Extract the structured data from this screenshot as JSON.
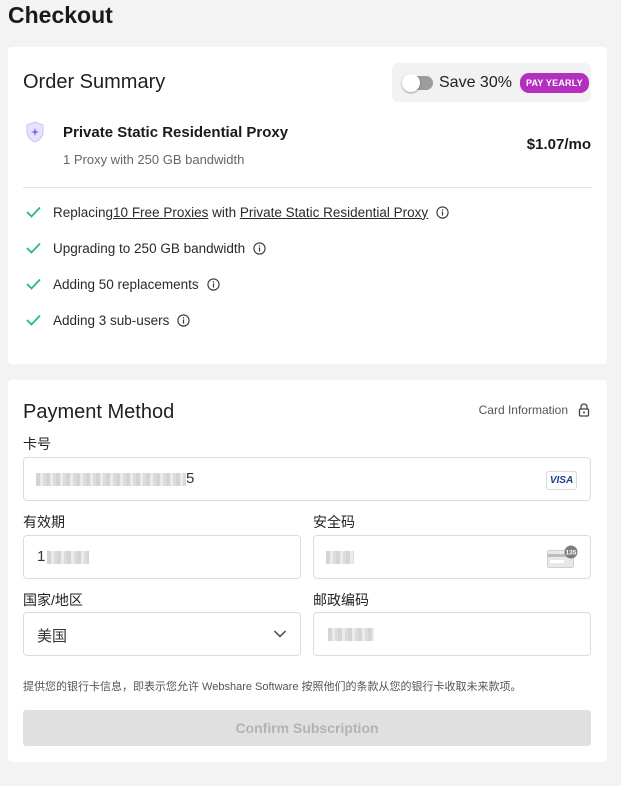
{
  "page": {
    "title": "Checkout"
  },
  "order_summary": {
    "title": "Order Summary",
    "save_label": "Save 30%",
    "pay_yearly": "PAY YEARLY",
    "product_icon": "shield-icon",
    "product_name": "Private Static Residential Proxy",
    "product_sub": "1 Proxy with 250 GB bandwidth",
    "price": "$1.07/mo",
    "features": {
      "f1_pre": "Replacing ",
      "f1_link1": "10 Free Proxies",
      "f1_mid": " with ",
      "f1_link2": "Private Static Residential Proxy",
      "f2": "Upgrading to 250 GB bandwidth",
      "f3": "Adding 50 replacements",
      "f4": "Adding 3 sub-users"
    }
  },
  "payment": {
    "title": "Payment Method",
    "card_info": "Card Information",
    "card_number_label": "卡号",
    "card_number_visible": "5",
    "card_brand": "VISA",
    "expiry_label": "有效期",
    "expiry_visible": "1",
    "cvc_label": "安全码",
    "cvc_badge": "135",
    "country_label": "国家/地区",
    "country_value": "美国",
    "postal_label": "邮政编码",
    "legal": "提供您的银行卡信息，即表示您允许 Webshare Software 按照他们的条款从您的银行卡收取未来款项。",
    "confirm": "Confirm Subscription"
  },
  "colors": {
    "accent": "#b42fc0",
    "check": "#2ab39a",
    "shield": "#7b6cf0"
  }
}
